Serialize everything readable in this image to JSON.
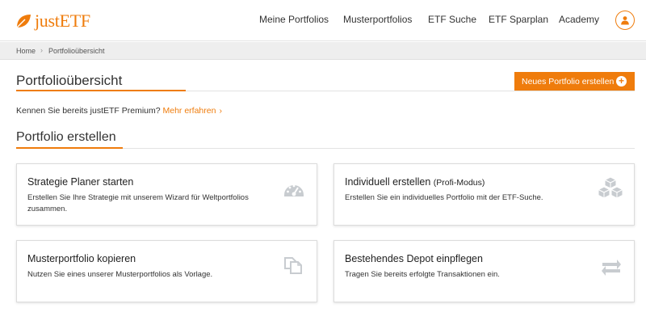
{
  "header": {
    "logo_text": "justETF",
    "nav": [
      {
        "label": "Meine Portfolios"
      },
      {
        "label": "Musterportfolios"
      },
      {
        "label": "ETF Suche"
      },
      {
        "label": "ETF Sparplan"
      },
      {
        "label": "Academy"
      }
    ],
    "user_icon": "user-icon"
  },
  "breadcrumb": {
    "items": [
      "Home",
      "Portfolioübersicht"
    ],
    "separator": "›"
  },
  "page": {
    "title": "Portfolioübersicht",
    "new_button_label": "Neues Portfolio erstellen",
    "premium_text": "Kennen Sie bereits justETF Premium?",
    "premium_link": "Mehr erfahren",
    "section_title": "Portfolio erstellen"
  },
  "cards": [
    {
      "title": "Strategie Planer starten",
      "subtitle": "",
      "description": "Erstellen Sie Ihre Strategie mit unserem Wizard für Weltportfolios zusammen.",
      "icon": "dashboard-icon"
    },
    {
      "title": "Individuell erstellen",
      "subtitle": "(Profi-Modus)",
      "description": "Erstellen Sie ein individuelles Portfolio mit der ETF-Suche.",
      "icon": "cubes-icon"
    },
    {
      "title": "Musterportfolio kopieren",
      "subtitle": "",
      "description": "Nutzen Sie eines unserer Musterportfolios als Vorlage.",
      "icon": "copy-icon"
    },
    {
      "title": "Bestehendes Depot einpflegen",
      "subtitle": "",
      "description": "Tragen Sie bereits erfolgte Transaktionen ein.",
      "icon": "exchange-icon"
    }
  ],
  "colors": {
    "accent": "#ef7c0c",
    "icon_gray": "#c8ccd0"
  }
}
